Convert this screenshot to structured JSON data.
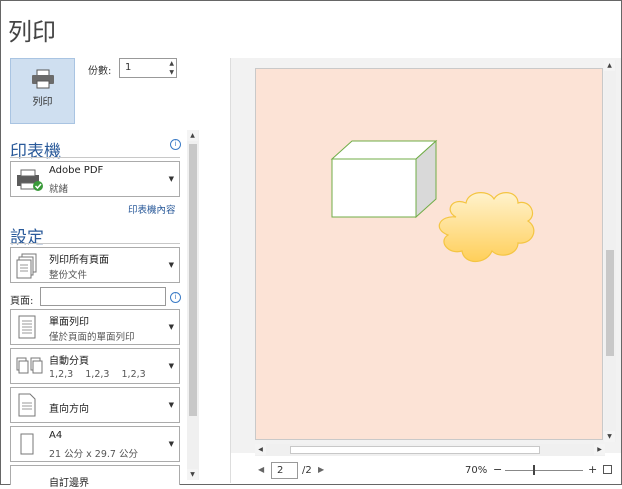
{
  "header": {
    "title": "列印"
  },
  "print_button": {
    "label": "列印"
  },
  "copies": {
    "label": "份數:",
    "value": "1"
  },
  "printer": {
    "heading": "印表機",
    "name": "Adobe PDF",
    "status": "就緒",
    "properties_link": "印表機內容"
  },
  "settings": {
    "heading": "設定",
    "pages_label": "頁面:",
    "pages_value": "",
    "items": [
      {
        "line1": "列印所有頁面",
        "line2": "整份文件"
      },
      {
        "line1": "單面列印",
        "line2": "僅於頁面的單面列印"
      },
      {
        "line1": "自動分頁",
        "line2": "1,2,3    1,2,3    1,2,3"
      },
      {
        "line1": "直向方向",
        "line2": ""
      },
      {
        "line1": "A4",
        "line2": "21 公分 x 29.7 公分"
      },
      {
        "line1": "自訂邊界",
        "line2": ""
      }
    ]
  },
  "preview": {
    "current_page": "2",
    "total_pages": "/2",
    "zoom": "70%",
    "page_color": "#fce3d6",
    "shapes": [
      {
        "type": "cube",
        "fill": "#ffffff",
        "side": "#d9d9d9",
        "stroke": "#70ad47"
      },
      {
        "type": "cloud",
        "fill": "#ffd966",
        "stroke": "#f4c542"
      }
    ]
  },
  "icons": {
    "printer": "printer-icon",
    "info": "info-icon",
    "zoom_minus": "−",
    "zoom_plus": "+",
    "fit": "fit-page-icon",
    "prev": "◀",
    "next": "▶"
  }
}
